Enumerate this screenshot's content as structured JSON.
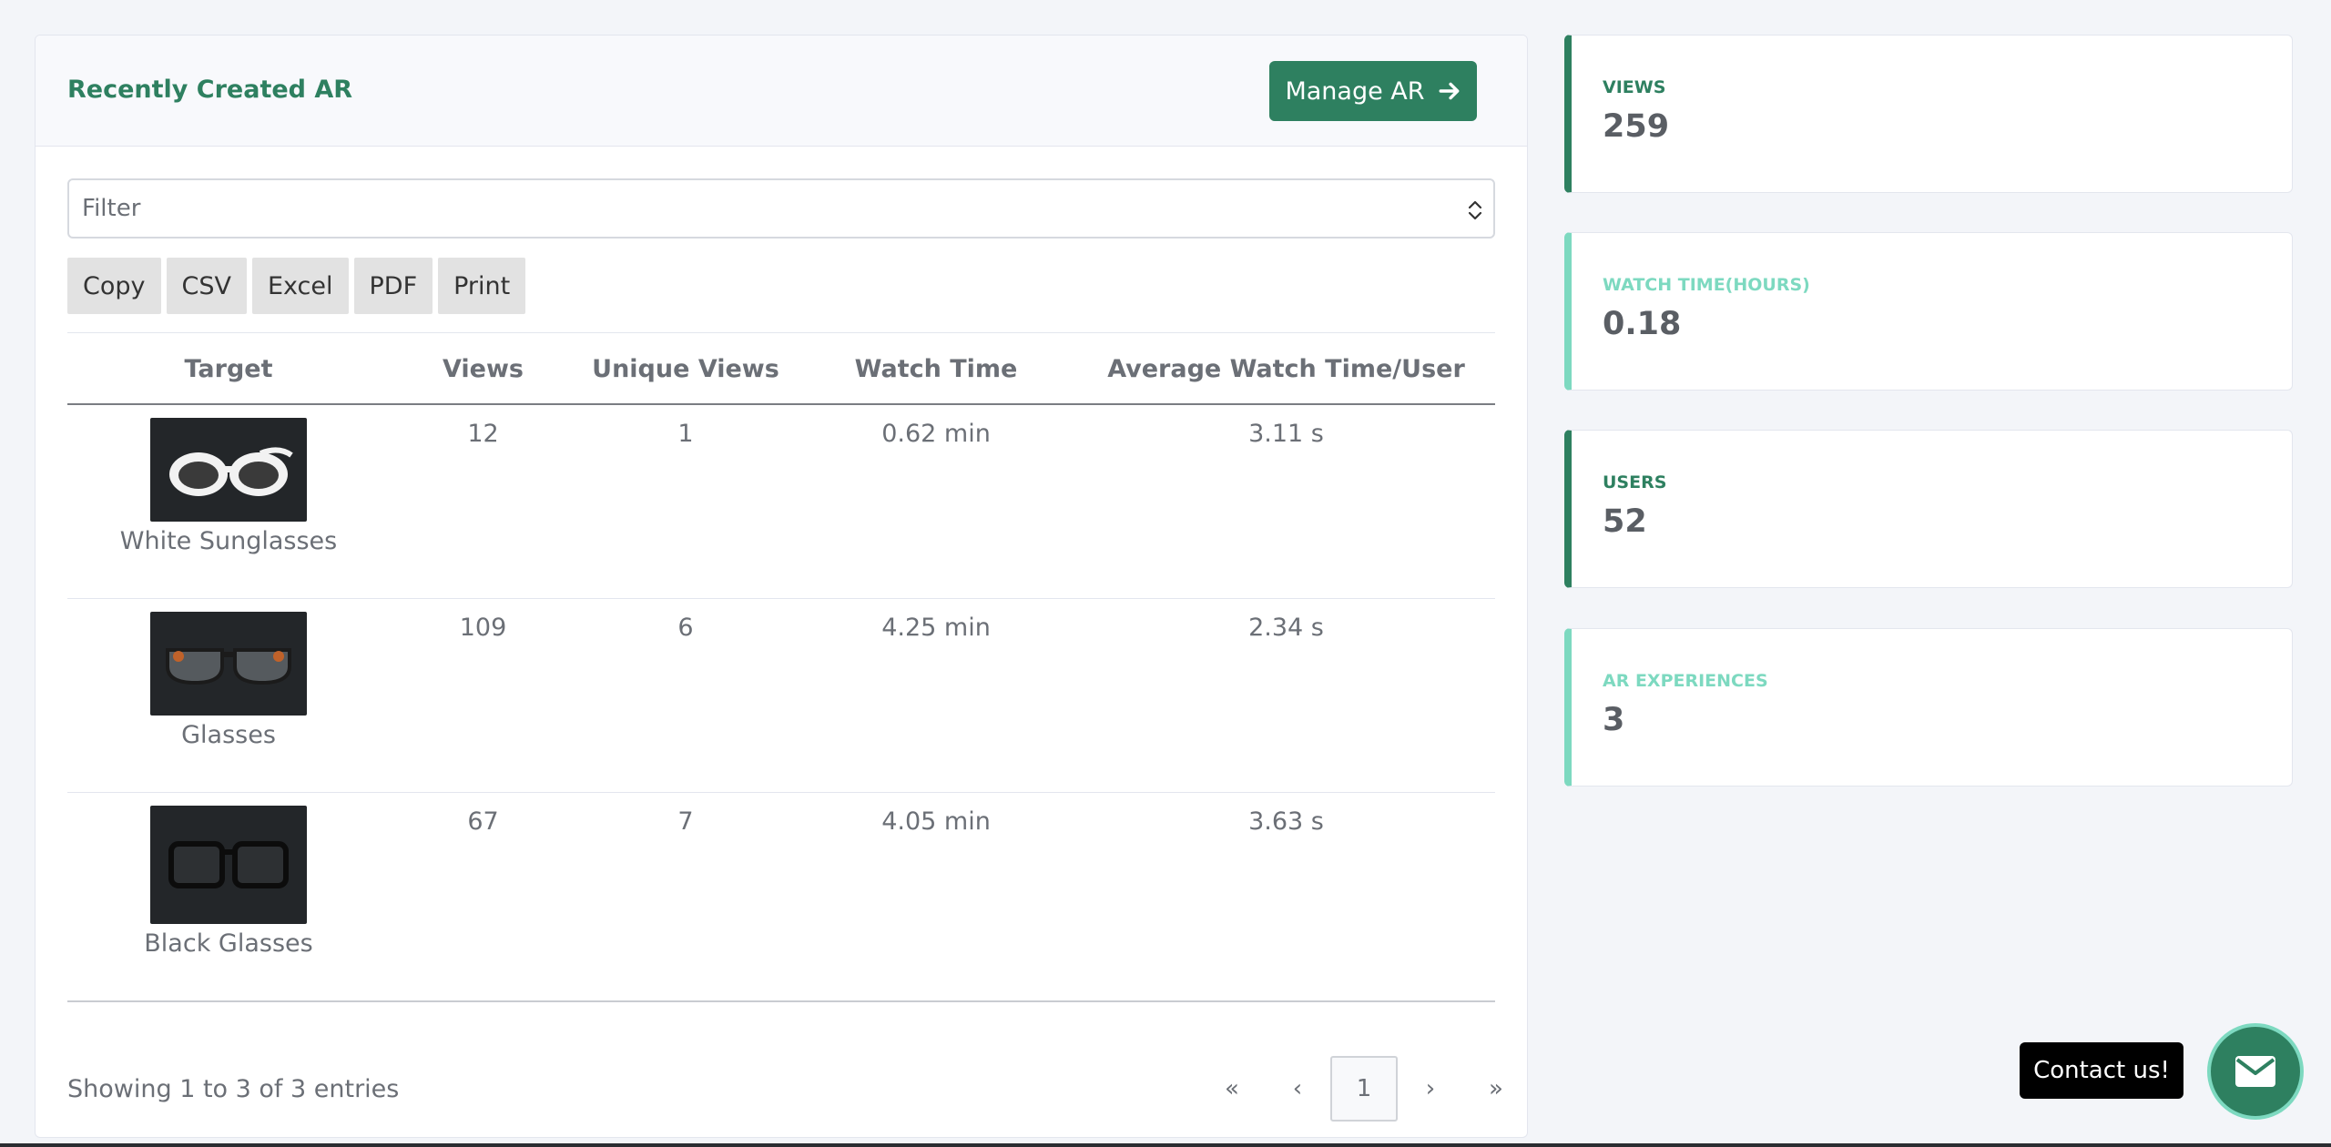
{
  "card": {
    "title": "Recently Created AR",
    "manage_button": "Manage AR"
  },
  "filter": {
    "value": "Filter"
  },
  "export_buttons": [
    "Copy",
    "CSV",
    "Excel",
    "PDF",
    "Print"
  ],
  "table": {
    "headers": [
      "Target",
      "Views",
      "Unique Views",
      "Watch Time",
      "Average Watch Time/User"
    ],
    "rows": [
      {
        "target": "White Sunglasses",
        "views": "12",
        "unique_views": "1",
        "watch_time": "0.62 min",
        "avg": "3.11 s"
      },
      {
        "target": "Glasses",
        "views": "109",
        "unique_views": "6",
        "watch_time": "4.25 min",
        "avg": "2.34 s"
      },
      {
        "target": "Black Glasses",
        "views": "67",
        "unique_views": "7",
        "watch_time": "4.05 min",
        "avg": "3.63 s"
      }
    ]
  },
  "footer": {
    "info": "Showing 1 to 3 of 3 entries",
    "pager": {
      "first": "«",
      "prev": "‹",
      "page": "1",
      "next": "›",
      "last": "»"
    }
  },
  "stats": [
    {
      "label": "VIEWS",
      "value": "259"
    },
    {
      "label": "WATCH TIME(HOURS)",
      "value": "0.18"
    },
    {
      "label": "USERS",
      "value": "52"
    },
    {
      "label": "AR EXPERIENCES",
      "value": "3"
    }
  ],
  "contact": {
    "label": "Contact us!"
  },
  "colors": {
    "accent": "#2e8060",
    "accent_light": "#7dd9c0"
  },
  "icons": {
    "manage": "arrow-right-icon",
    "contact": "envelope-icon",
    "filter": "chevron-up-down-icon"
  }
}
